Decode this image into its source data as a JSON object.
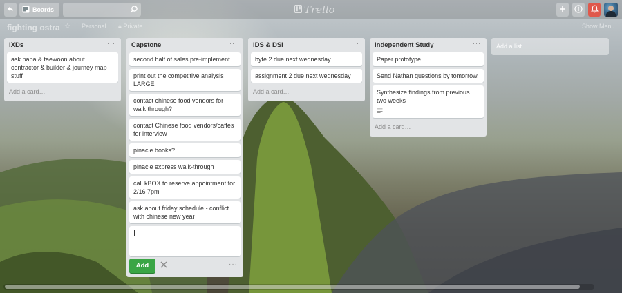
{
  "header": {
    "boards_label": "Boards",
    "search_placeholder": "",
    "logo_text": "Trello"
  },
  "board": {
    "title": "fighting ostra",
    "visibility_personal": "Personal",
    "visibility_private": "Private",
    "show_menu": "Show Menu"
  },
  "lists": [
    {
      "title": "IXDs",
      "cards": [
        "ask papa & taewoon about contractor & builder & journey map stuff"
      ],
      "add_card": "Add a card…"
    },
    {
      "title": "Capstone",
      "cards": [
        "second half of sales pre-implement",
        "print out the competitive analysis LARGE",
        "contact chinese food vendors for walk through?",
        "contact Chinese food vendors/caffes for interview",
        "pinacle books?",
        "pinacle express walk-through",
        "call kBOX to reserve appointment for 2/16 7pm",
        "ask about friday schedule - conflict with chinese new year"
      ],
      "composer_value": "",
      "add_button": "Add"
    },
    {
      "title": "IDS & DSI",
      "cards": [
        "byte 2 due next wednesday",
        "assignment 2 due next wednesday"
      ],
      "add_card": "Add a card…"
    },
    {
      "title": "Independent Study",
      "cards": [
        "Paper prototype",
        "Send Nathan questions by tomorrow.",
        "Synthesize findings from previous two weeks"
      ],
      "add_card": "Add a card…"
    }
  ],
  "add_list": "Add a list…",
  "colors": {
    "add_button_green": "#3aa545",
    "notification_red": "#e0584b",
    "list_bg": "#e2e4e6"
  },
  "icons": [
    "back-icon",
    "boards-icon",
    "search-icon",
    "trello-logo-icon",
    "plus-icon",
    "info-icon",
    "bell-icon",
    "star-icon",
    "lock-icon",
    "description-icon",
    "close-icon"
  ]
}
